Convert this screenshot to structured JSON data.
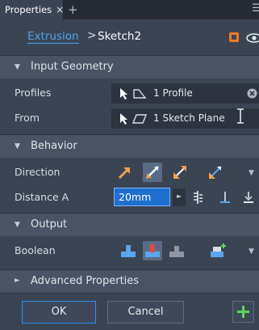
{
  "tab": {
    "label": "Properties",
    "close": "×",
    "add": "+",
    "menu": "☰"
  },
  "breadcrumb": {
    "parent": "Extrusion",
    "separator": ">",
    "current": "Sketch2"
  },
  "sections": {
    "input_geometry": "Input Geometry",
    "behavior": "Behavior",
    "output": "Output",
    "advanced": "Advanced Properties"
  },
  "fields": {
    "profiles_label": "Profiles",
    "profiles_value": "1 Profile",
    "from_label": "From",
    "from_value": "1 Sketch Plane",
    "direction_label": "Direction",
    "distance_label": "Distance A",
    "distance_value": "20mm",
    "boolean_label": "Boolean"
  },
  "buttons": {
    "ok": "OK",
    "cancel": "Cancel"
  },
  "colors": {
    "accent": "#2d8ff0",
    "link": "#4aa4f0",
    "cube": "#f07a22",
    "plus": "#5fd35a",
    "boolean_active": "#e04848"
  }
}
